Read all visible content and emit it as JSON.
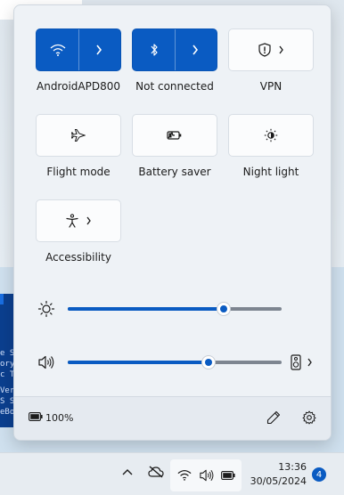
{
  "background": {
    "terminal_lines": [
      "e S",
      "ory",
      "c T",
      "Ver",
      "S S",
      "eBo"
    ]
  },
  "quick_settings": {
    "tiles": [
      {
        "label": "AndroidAPD800",
        "state": "on",
        "icon": "wifi-icon"
      },
      {
        "label": "Not connected",
        "state": "on",
        "icon": "bluetooth-icon"
      },
      {
        "label": "VPN",
        "state": "off",
        "icon": "shield-icon"
      },
      {
        "label": "Flight mode",
        "state": "off",
        "icon": "airplane-icon"
      },
      {
        "label": "Battery saver",
        "state": "off",
        "icon": "battery-saver-icon"
      },
      {
        "label": "Night light",
        "state": "off",
        "icon": "night-light-icon"
      },
      {
        "label": "Accessibility",
        "state": "off",
        "icon": "accessibility-icon"
      }
    ],
    "brightness": {
      "icon": "brightness-icon",
      "level": 0.73
    },
    "volume": {
      "icon": "speaker-icon",
      "level": 0.66,
      "output_icon": "audio-output-icon"
    },
    "footer": {
      "battery_text": "100%",
      "battery_icon": "battery-icon",
      "edit_icon": "pencil-icon",
      "settings_icon": "gear-icon"
    }
  },
  "taskbar": {
    "time": "13:36",
    "date": "30/05/2024",
    "notification_count": "4",
    "accent": "#0a5bc2"
  }
}
